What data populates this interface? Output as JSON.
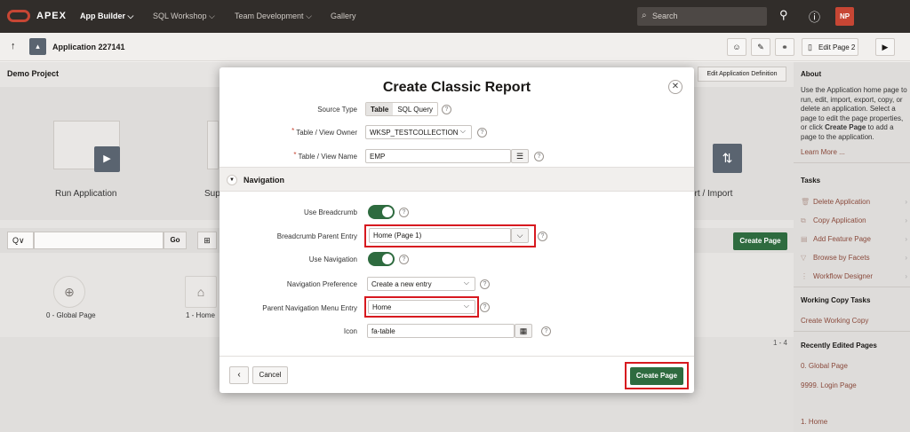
{
  "header": {
    "brand": "APEX",
    "nav": [
      "App Builder",
      "SQL Workshop",
      "Team Development",
      "Gallery"
    ],
    "search_placeholder": "Search",
    "avatar_initials": "NP"
  },
  "appbar": {
    "app_title": "Application 227141",
    "edit_page_label": "Edit Page 2"
  },
  "main": {
    "project_title": "Demo Project",
    "edit_definition_label": "Edit Application Definition",
    "run_app_label": "Run Application",
    "supporting_label": "Sup",
    "export_label": "ort / Import",
    "search_prefix": "Q∨",
    "go_label": "Go",
    "create_page_label": "Create Page",
    "tiles": [
      {
        "label": "0 - Global Page"
      },
      {
        "label": "1 - Home"
      }
    ],
    "pager": "1 - 4"
  },
  "sidebar": {
    "about_heading": "About",
    "about_text_1": "Use the Application home page to run, edit, import, export, copy, or delete an application. Select a page to edit the page properties, or click",
    "about_bold": "Create Page",
    "about_text_2": "to add a page to the application.",
    "learn_more": "Learn More ...",
    "tasks_heading": "Tasks",
    "tasks": [
      {
        "label": "Delete Application"
      },
      {
        "label": "Copy Application"
      },
      {
        "label": "Add Feature Page"
      },
      {
        "label": "Browse by Facets"
      },
      {
        "label": "Workflow Designer"
      }
    ],
    "working_copy_heading": "Working Copy Tasks",
    "working_copy_link": "Create Working Copy",
    "recent_heading": "Recently Edited Pages",
    "recent": [
      "0. Global Page",
      "9999. Login Page",
      "1. Home"
    ]
  },
  "modal": {
    "title": "Create Classic Report",
    "source_type_label": "Source Type",
    "source_type_options": [
      "Table",
      "SQL Query"
    ],
    "owner_label": "Table / View Owner",
    "owner_value": "WKSP_TESTCOLLECTION",
    "name_label": "Table / View Name",
    "name_value": "EMP",
    "navigation_heading": "Navigation",
    "use_breadcrumb_label": "Use Breadcrumb",
    "breadcrumb_parent_label": "Breadcrumb Parent Entry",
    "breadcrumb_parent_value": "Home (Page 1)",
    "use_navigation_label": "Use Navigation",
    "nav_pref_label": "Navigation Preference",
    "nav_pref_value": "Create a new entry",
    "parent_nav_label": "Parent Navigation Menu Entry",
    "parent_nav_value": "Home",
    "icon_label": "Icon",
    "icon_value": "fa-table",
    "cancel_label": "Cancel",
    "create_label": "Create Page"
  },
  "colors": {
    "topbar": "#312d2a",
    "brand_red": "#c74634",
    "primary_green": "#2e6b3f",
    "highlight_red": "#d7191f"
  }
}
